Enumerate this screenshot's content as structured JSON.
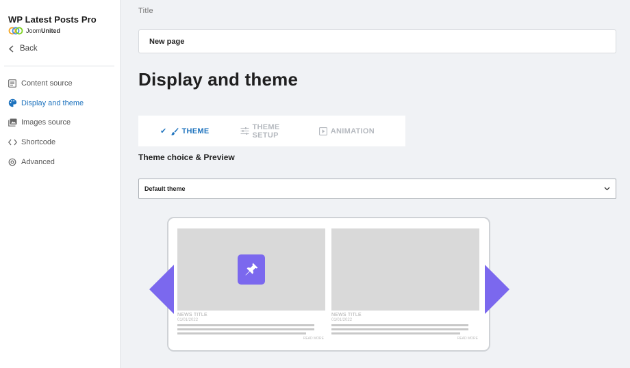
{
  "app": {
    "name": "WP Latest Posts Pro",
    "vendor_prefix": "Joom",
    "vendor_suffix": "United"
  },
  "sidebar": {
    "back_label": "Back",
    "items": [
      {
        "label": "Content source",
        "icon": "list-icon",
        "active": false
      },
      {
        "label": "Display and theme",
        "icon": "palette-icon",
        "active": true
      },
      {
        "label": "Images source",
        "icon": "image-icon",
        "active": false
      },
      {
        "label": "Shortcode",
        "icon": "code-icon",
        "active": false
      },
      {
        "label": "Advanced",
        "icon": "gear-icon",
        "active": false
      }
    ]
  },
  "form": {
    "title_label": "Title",
    "title_value": "New page"
  },
  "page": {
    "heading": "Display and theme"
  },
  "tabs": [
    {
      "label": "THEME",
      "icon": "brush-icon",
      "active": true
    },
    {
      "label": "THEME SETUP",
      "icon": "sliders-icon",
      "active": false
    },
    {
      "label": "ANIMATION",
      "icon": "play-icon",
      "active": false
    }
  ],
  "theme": {
    "section_title": "Theme choice & Preview",
    "selected": "Default theme"
  },
  "preview": {
    "cards": [
      {
        "news_title": "NEWS TITLE",
        "date": "01/01/2022",
        "read_more": "READ MORE"
      },
      {
        "news_title": "NEWS TITLE",
        "date": "01/01/2022",
        "read_more": "READ MORE"
      }
    ]
  },
  "colors": {
    "accent": "#1e73be",
    "preview_accent": "#7b68ee",
    "muted_tab": "#b5b9bf",
    "background": "#f0f2f5"
  }
}
